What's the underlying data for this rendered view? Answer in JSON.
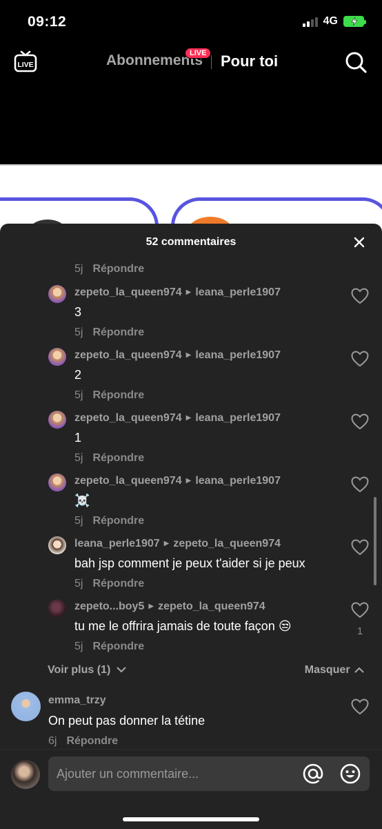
{
  "status_bar": {
    "time": "09:12",
    "network": "4G",
    "signal_bars": 2
  },
  "top_nav": {
    "live_icon_label": "LIVE",
    "tabs": [
      {
        "label": "Abonnements",
        "active": false,
        "badge": "LIVE"
      },
      {
        "label": "Pour toi",
        "active": true
      }
    ],
    "icons": [
      "live-tv-icon",
      "search-icon"
    ]
  },
  "comments_sheet": {
    "title": "52 commentaires",
    "reply_label": "Répondre",
    "top_fragment": {
      "age": "5j"
    },
    "replies": [
      {
        "author": "zepeto_la_queen974",
        "reply_to": "leana_perle1907",
        "text": "3",
        "age": "5j",
        "likes": ""
      },
      {
        "author": "zepeto_la_queen974",
        "reply_to": "leana_perle1907",
        "text": "2",
        "age": "5j",
        "likes": ""
      },
      {
        "author": "zepeto_la_queen974",
        "reply_to": "leana_perle1907",
        "text": "1",
        "age": "5j",
        "likes": ""
      },
      {
        "author": "zepeto_la_queen974",
        "reply_to": "leana_perle1907",
        "text": "☠️",
        "age": "5j",
        "likes": ""
      },
      {
        "author": "leana_perle1907",
        "reply_to": "zepeto_la_queen974",
        "text": "bah jsp comment je peux t'aider si je peux",
        "age": "5j",
        "likes": ""
      },
      {
        "author": "zepeto...boy5",
        "reply_to": "zepeto_la_queen974",
        "text": "tu me le offrira jamais de toute façon 😒",
        "age": "5j",
        "likes": "1"
      }
    ],
    "see_more": "Voir plus (1)",
    "hide": "Masquer",
    "comments": [
      {
        "author": "emma_trzy",
        "text": "On peut pas donner la tétine",
        "age": "6j"
      }
    ]
  },
  "composer": {
    "placeholder": "Ajouter un commentaire..."
  },
  "colors": {
    "accent": "#fe2c55",
    "sheet_bg": "#232323",
    "input_bg": "#3a3a3a",
    "battery": "#3ddc4a"
  }
}
